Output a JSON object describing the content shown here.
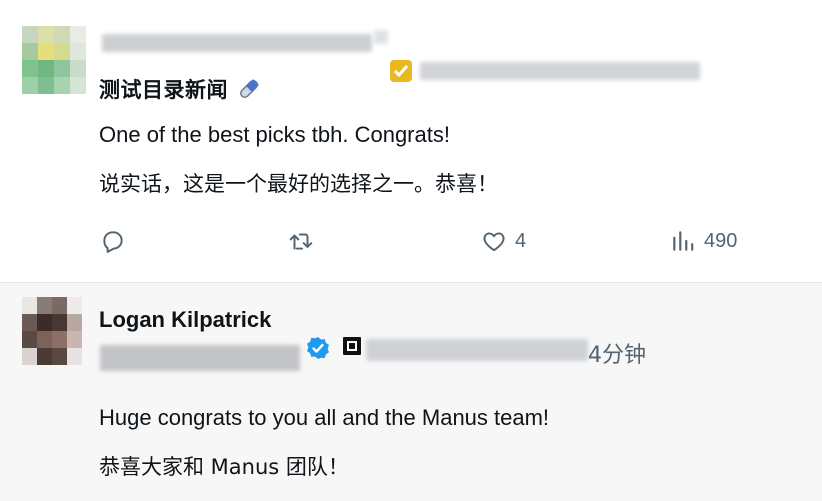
{
  "tweet1": {
    "display_name": "测试目录新闻",
    "text_en": "One of the best picks tbh. Congrats!",
    "text_zh": "说实话，这是一个最好的选择之一。恭喜！",
    "actions": {
      "reply_count": "",
      "retweet_count": "",
      "like_count": "4",
      "views_count": "490"
    },
    "icons": [
      "reply-icon",
      "retweet-icon",
      "like-icon",
      "views-icon",
      "pill-icon",
      "gold-badge-icon"
    ]
  },
  "tweet2": {
    "display_name": "Logan Kilpatrick",
    "time": "4分钟",
    "text_en": "Huge congrats to you all and the Manus team!",
    "text_zh": "恭喜大家和 Manus 团队！",
    "icons": [
      "verified-badge-icon",
      "affiliate-square-icon"
    ]
  },
  "colors": {
    "text": "#0f1419",
    "muted": "#536471",
    "reply_bg": "#f7f7f7",
    "verified_blue": "#1d9bf0",
    "gold_badge": "#e8b923"
  }
}
